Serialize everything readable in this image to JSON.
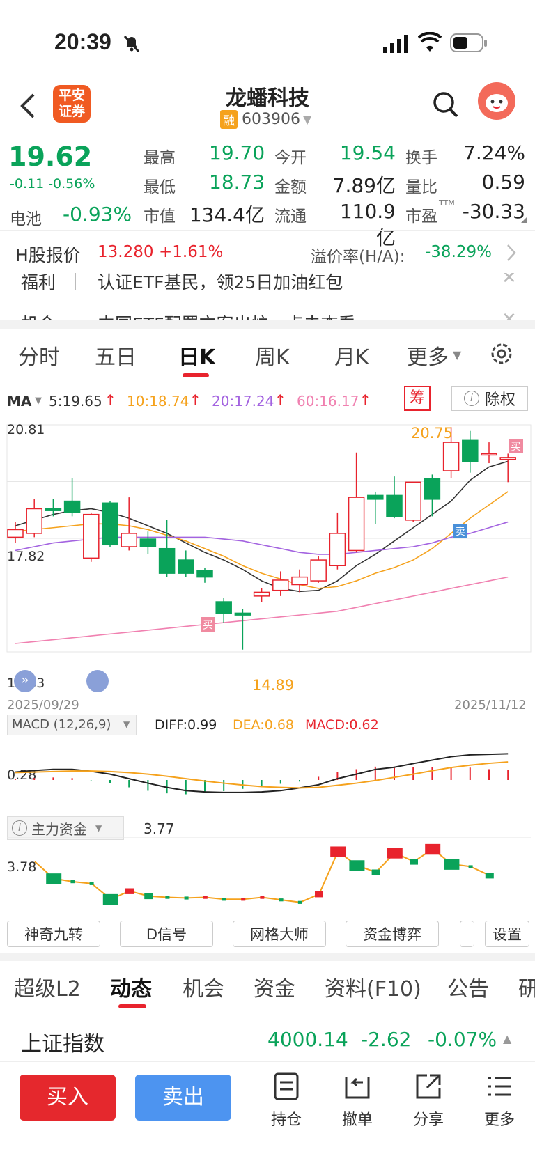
{
  "status": {
    "time": "20:39"
  },
  "header": {
    "logo_line1": "平安",
    "logo_line2": "证券",
    "title": "龙蟠科技",
    "badge": "融",
    "code": "603906"
  },
  "quote": {
    "price": "19.62",
    "change": "-0.11 -0.56%",
    "sector_label": "电池",
    "sector_change": "-0.93%",
    "high_label": "最高",
    "high": "19.70",
    "open_label": "今开",
    "open": "19.54",
    "turnover_label": "换手",
    "turnover": "7.24%",
    "low_label": "最低",
    "low": "18.73",
    "amount_label": "金额",
    "amount": "7.89亿",
    "vol_ratio_label": "量比",
    "vol_ratio": "0.59",
    "mcap_label": "市值",
    "mcap": "134.4亿",
    "float_label": "流通",
    "float": "110.9亿",
    "pe_label": "市盈",
    "pe_sup": "TTM",
    "pe": "-30.33"
  },
  "hshare": {
    "label": "H股报价",
    "price": "13.280",
    "pct": "+1.61%",
    "premium_label": "溢价率(H/A):",
    "premium": "-38.29%"
  },
  "banners": [
    "福利",
    "认证ETF基民，领25日加油红包",
    "机会",
    "中国ETF配置方案出炉，点击查看"
  ],
  "tabs": {
    "t1": "分时",
    "t2": "五日",
    "t3": "日K",
    "t4": "周K",
    "t5": "月K",
    "t6": "更多"
  },
  "ma": {
    "label": "MA",
    "ma5": "5:19.65",
    "ma10": "10:18.74",
    "ma20": "20:17.24",
    "ma60": "60:16.17",
    "chip": "筹",
    "fq": "除权"
  },
  "chart_data": {
    "type": "candlestick",
    "ylim": [
      14.83,
      20.81
    ],
    "y_ticks": [
      "20.81",
      "17.82",
      "14.83"
    ],
    "x_start": "2025/09/29",
    "x_end": "2025/11/12",
    "high_annotation": "20.75",
    "low_annotation": "14.89",
    "buy_mark": "买",
    "sell_mark": "卖",
    "candles": [
      {
        "o": 17.85,
        "c": 18.05,
        "h": 18.25,
        "l": 17.7
      },
      {
        "o": 17.95,
        "c": 18.6,
        "h": 18.85,
        "l": 17.85
      },
      {
        "o": 18.6,
        "c": 18.55,
        "h": 18.85,
        "l": 18.4
      },
      {
        "o": 18.8,
        "c": 18.5,
        "h": 19.4,
        "l": 18.4
      },
      {
        "o": 17.3,
        "c": 18.45,
        "h": 18.5,
        "l": 17.2
      },
      {
        "o": 18.75,
        "c": 17.65,
        "h": 18.8,
        "l": 17.6
      },
      {
        "o": 17.6,
        "c": 17.95,
        "h": 18.9,
        "l": 17.5
      },
      {
        "o": 17.8,
        "c": 17.6,
        "h": 18.0,
        "l": 17.4
      },
      {
        "o": 17.55,
        "c": 16.9,
        "h": 18.3,
        "l": 16.8
      },
      {
        "o": 17.25,
        "c": 16.9,
        "h": 17.5,
        "l": 16.8
      },
      {
        "o": 16.98,
        "c": 16.8,
        "h": 17.05,
        "l": 16.65
      },
      {
        "o": 16.15,
        "c": 15.85,
        "h": 16.25,
        "l": 15.6
      },
      {
        "o": 15.85,
        "c": 15.8,
        "h": 15.95,
        "l": 14.89
      },
      {
        "o": 16.3,
        "c": 16.4,
        "h": 16.5,
        "l": 16.15
      },
      {
        "o": 16.45,
        "c": 16.72,
        "h": 16.95,
        "l": 16.3
      },
      {
        "o": 16.6,
        "c": 16.8,
        "h": 17.0,
        "l": 16.4
      },
      {
        "o": 16.7,
        "c": 17.25,
        "h": 17.35,
        "l": 16.65
      },
      {
        "o": 17.1,
        "c": 17.95,
        "h": 18.5,
        "l": 17.0
      },
      {
        "o": 17.5,
        "c": 18.9,
        "h": 20.08,
        "l": 17.45
      },
      {
        "o": 18.95,
        "c": 18.85,
        "h": 19.05,
        "l": 18.2
      },
      {
        "o": 18.95,
        "c": 18.4,
        "h": 19.45,
        "l": 18.35
      },
      {
        "o": 18.3,
        "c": 19.3,
        "h": 19.3,
        "l": 18.25
      },
      {
        "o": 19.4,
        "c": 18.85,
        "h": 19.5,
        "l": 18.4
      },
      {
        "o": 19.6,
        "c": 20.35,
        "h": 20.75,
        "l": 19.4
      },
      {
        "o": 20.4,
        "c": 19.85,
        "h": 20.65,
        "l": 19.55
      },
      {
        "o": 20.05,
        "c": 20.05,
        "h": 20.35,
        "l": 19.8
      },
      {
        "o": 19.9,
        "c": 19.95,
        "h": 20.05,
        "l": 19.3
      }
    ],
    "series": [
      {
        "name": "MA5",
        "color": "#333333",
        "values": [
          18.15,
          18.3,
          18.45,
          18.55,
          18.6,
          18.5,
          18.35,
          18.15,
          17.95,
          17.7,
          17.45,
          17.25,
          17.0,
          16.7,
          16.5,
          16.42,
          16.45,
          16.7,
          17.1,
          17.4,
          17.75,
          18.1,
          18.45,
          18.8,
          19.35,
          19.7,
          19.85
        ]
      },
      {
        "name": "MA10",
        "color": "#f5a21d",
        "values": [
          18.0,
          18.05,
          18.1,
          18.15,
          18.2,
          18.2,
          18.15,
          18.05,
          17.9,
          17.75,
          17.55,
          17.35,
          17.1,
          16.9,
          16.75,
          16.6,
          16.5,
          16.55,
          16.7,
          16.9,
          17.05,
          17.25,
          17.55,
          17.95,
          18.35,
          18.7,
          19.05
        ]
      },
      {
        "name": "MA20",
        "color": "#a363e0",
        "values": [
          17.5,
          17.6,
          17.7,
          17.75,
          17.8,
          17.85,
          17.85,
          17.85,
          17.85,
          17.85,
          17.85,
          17.8,
          17.75,
          17.65,
          17.55,
          17.45,
          17.4,
          17.4,
          17.45,
          17.5,
          17.55,
          17.6,
          17.7,
          17.85,
          17.95,
          18.1,
          18.25
        ]
      },
      {
        "name": "MA60",
        "color": "#f080b0",
        "values": [
          15.05,
          15.1,
          15.15,
          15.2,
          15.25,
          15.3,
          15.35,
          15.4,
          15.45,
          15.5,
          15.55,
          15.6,
          15.65,
          15.7,
          15.75,
          15.8,
          15.85,
          15.9,
          16.0,
          16.1,
          16.2,
          16.3,
          16.4,
          16.5,
          16.6,
          16.7,
          16.8
        ]
      }
    ]
  },
  "macd": {
    "title": "MACD (12,26,9)",
    "diff": "DIFF:0.99",
    "dea": "DEA:0.68",
    "macd": "MACD:0.62",
    "tick": "0.28",
    "diff_values": [
      0.3,
      0.36,
      0.4,
      0.4,
      0.33,
      0.22,
      0.05,
      -0.12,
      -0.28,
      -0.4,
      -0.45,
      -0.47,
      -0.47,
      -0.45,
      -0.4,
      -0.3,
      -0.18,
      0.05,
      0.22,
      0.4,
      0.48,
      0.62,
      0.75,
      0.88,
      0.95,
      0.97,
      0.99
    ],
    "dea_values": [
      0.28,
      0.3,
      0.32,
      0.34,
      0.34,
      0.32,
      0.28,
      0.22,
      0.14,
      0.05,
      -0.04,
      -0.12,
      -0.19,
      -0.25,
      -0.28,
      -0.3,
      -0.28,
      -0.2,
      -0.12,
      -0.02,
      0.1,
      0.22,
      0.35,
      0.47,
      0.56,
      0.63,
      0.68
    ],
    "hist_values": [
      0.04,
      0.12,
      0.16,
      0.12,
      -0.02,
      -0.2,
      -0.46,
      -0.68,
      -0.84,
      -0.9,
      -0.82,
      -0.7,
      -0.56,
      -0.4,
      -0.24,
      -0.1,
      0.2,
      0.5,
      0.68,
      0.84,
      0.76,
      0.8,
      0.8,
      0.82,
      0.78,
      0.68,
      0.62
    ]
  },
  "capital": {
    "title": "主力资金",
    "value": "3.77",
    "tick": "3.78",
    "values": [
      0.72,
      0.45,
      0.4,
      0.37,
      0.12,
      0.25,
      0.17,
      0.15,
      0.14,
      0.15,
      0.12,
      0.12,
      0.15,
      0.11,
      0.07,
      0.2,
      0.88,
      0.66,
      0.55,
      0.86,
      0.72,
      0.92,
      0.68,
      0.64,
      0.5
    ]
  },
  "indicators": {
    "b1": "神奇九转",
    "b2": "D信号",
    "b3": "网格大师",
    "b4": "资金博弈",
    "b5": "设置"
  },
  "nav": {
    "n1": "超级L2",
    "n2": "动态",
    "n3": "机会",
    "n4": "资金",
    "n5": "资料(F10)",
    "n6": "公告",
    "n7": "研"
  },
  "index": {
    "name": "上证指数",
    "value": "4000.14",
    "change": "-2.62",
    "pct": "-0.07%"
  },
  "bottom": {
    "buy": "买入",
    "sell": "卖出",
    "hold": "持仓",
    "cancel": "撤单",
    "share": "分享",
    "more": "更多"
  }
}
